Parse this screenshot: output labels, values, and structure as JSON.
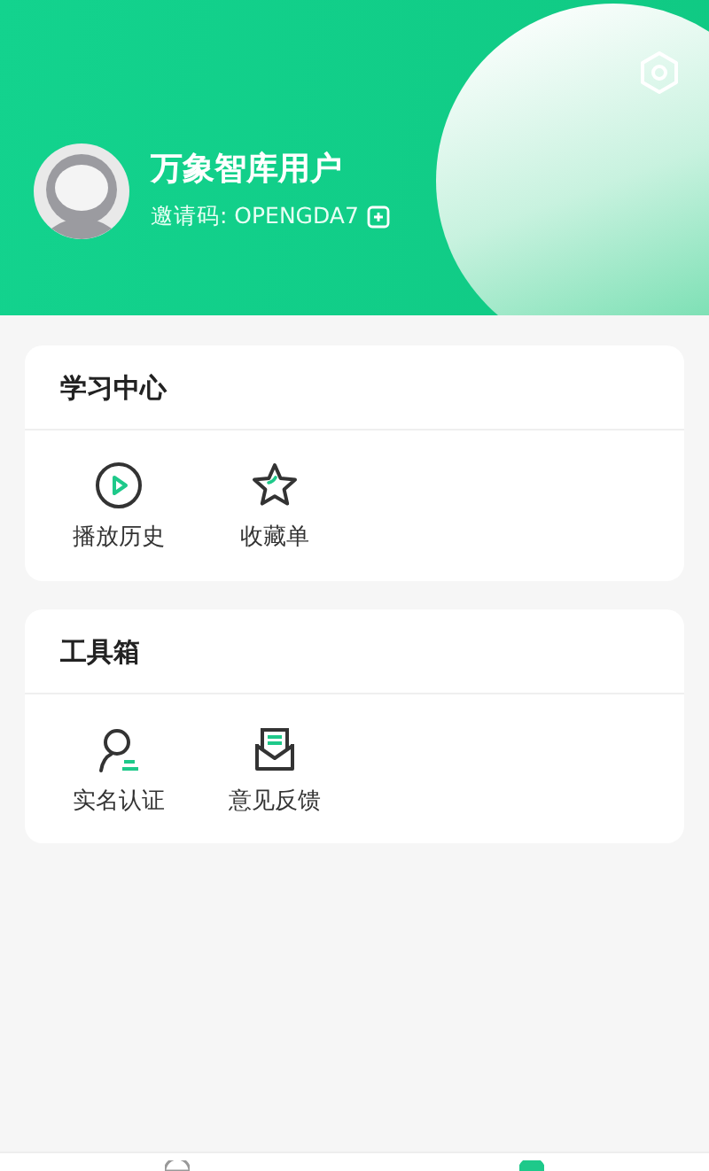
{
  "profile": {
    "name": "万象智库用户",
    "invite_label": "邀请码: OPENGDA7"
  },
  "sections": [
    {
      "title": "学习中心",
      "items": [
        {
          "label": "播放历史",
          "kind": "play"
        },
        {
          "label": "收藏单",
          "kind": "star"
        }
      ]
    },
    {
      "title": "工具箱",
      "items": [
        {
          "label": "实名认证",
          "kind": "user"
        },
        {
          "label": "意见反馈",
          "kind": "mail"
        }
      ]
    }
  ],
  "tab_bar": [
    {
      "selected": false
    },
    {
      "selected": true
    }
  ]
}
